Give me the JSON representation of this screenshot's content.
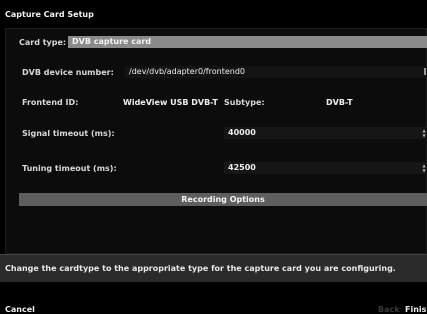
{
  "window": {
    "title": "Capture Card Setup"
  },
  "card_type": {
    "label": "Card type:",
    "value": "DVB capture card"
  },
  "dvb_device": {
    "label": "DVB device number:",
    "value": "/dev/dvb/adapter0/frontend0"
  },
  "frontend": {
    "id_label": "Frontend ID:",
    "id_value": "WideView USB DVB-T",
    "subtype_label": "Subtype:",
    "subtype_value": "DVB-T"
  },
  "signal_timeout": {
    "label": "Signal timeout (ms):",
    "value": "40000"
  },
  "tuning_timeout": {
    "label": "Tuning timeout (ms):",
    "value": "42500"
  },
  "recording_options": {
    "label": "Recording Options"
  },
  "help": {
    "text": "Change the cardtype to the appropriate type for the capture card you are configuring."
  },
  "footer": {
    "cancel_label": "Cancel",
    "back_label": "Back",
    "finish_label": "Finis"
  }
}
